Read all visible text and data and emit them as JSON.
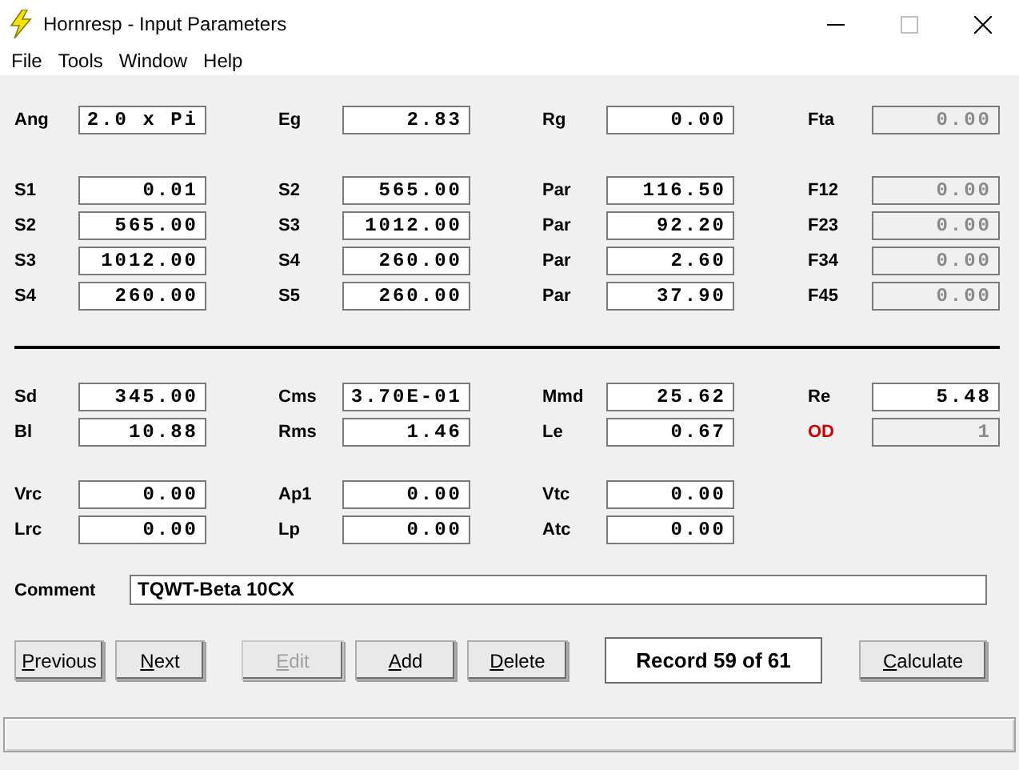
{
  "window": {
    "title": "Hornresp - Input Parameters"
  },
  "menu": [
    "File",
    "Tools",
    "Window",
    "Help"
  ],
  "groups": [
    {
      "kind": "fields",
      "rows": [
        [
          {
            "label": "Ang",
            "value": "2.0 x Pi",
            "disabled": false,
            "alert": false
          },
          {
            "label": "Eg",
            "value": "2.83",
            "disabled": false,
            "alert": false
          },
          {
            "label": "Rg",
            "value": "0.00",
            "disabled": false,
            "alert": false
          },
          {
            "label": "Fta",
            "value": "0.00",
            "disabled": true,
            "alert": false
          }
        ]
      ]
    },
    {
      "kind": "fields",
      "rows": [
        [
          {
            "label": "S1",
            "value": "0.01",
            "disabled": false,
            "alert": false
          },
          {
            "label": "S2",
            "value": "565.00",
            "disabled": false,
            "alert": false
          },
          {
            "label": "Par",
            "value": "116.50",
            "disabled": false,
            "alert": false
          },
          {
            "label": "F12",
            "value": "0.00",
            "disabled": true,
            "alert": false
          }
        ],
        [
          {
            "label": "S2",
            "value": "565.00",
            "disabled": false,
            "alert": false
          },
          {
            "label": "S3",
            "value": "1012.00",
            "disabled": false,
            "alert": false
          },
          {
            "label": "Par",
            "value": "92.20",
            "disabled": false,
            "alert": false
          },
          {
            "label": "F23",
            "value": "0.00",
            "disabled": true,
            "alert": false
          }
        ],
        [
          {
            "label": "S3",
            "value": "1012.00",
            "disabled": false,
            "alert": false
          },
          {
            "label": "S4",
            "value": "260.00",
            "disabled": false,
            "alert": false
          },
          {
            "label": "Par",
            "value": "2.60",
            "disabled": false,
            "alert": false
          },
          {
            "label": "F34",
            "value": "0.00",
            "disabled": true,
            "alert": false
          }
        ],
        [
          {
            "label": "S4",
            "value": "260.00",
            "disabled": false,
            "alert": false
          },
          {
            "label": "S5",
            "value": "260.00",
            "disabled": false,
            "alert": false
          },
          {
            "label": "Par",
            "value": "37.90",
            "disabled": false,
            "alert": false
          },
          {
            "label": "F45",
            "value": "0.00",
            "disabled": true,
            "alert": false
          }
        ]
      ]
    },
    {
      "kind": "rule"
    },
    {
      "kind": "fields",
      "rows": [
        [
          {
            "label": "Sd",
            "value": "345.00",
            "disabled": false,
            "alert": false
          },
          {
            "label": "Cms",
            "value": "3.70E-01",
            "disabled": false,
            "alert": false
          },
          {
            "label": "Mmd",
            "value": "25.62",
            "disabled": false,
            "alert": false
          },
          {
            "label": "Re",
            "value": "5.48",
            "disabled": false,
            "alert": false
          }
        ],
        [
          {
            "label": "Bl",
            "value": "10.88",
            "disabled": false,
            "alert": false
          },
          {
            "label": "Rms",
            "value": "1.46",
            "disabled": false,
            "alert": false
          },
          {
            "label": "Le",
            "value": "0.67",
            "disabled": false,
            "alert": false
          },
          {
            "label": "OD",
            "value": "1",
            "disabled": true,
            "alert": true
          }
        ]
      ]
    },
    {
      "kind": "fields",
      "rows": [
        [
          {
            "label": "Vrc",
            "value": "0.00",
            "disabled": false,
            "alert": false
          },
          {
            "label": "Ap1",
            "value": "0.00",
            "disabled": false,
            "alert": false
          },
          {
            "label": "Vtc",
            "value": "0.00",
            "disabled": false,
            "alert": false
          }
        ],
        [
          {
            "label": "Lrc",
            "value": "0.00",
            "disabled": false,
            "alert": false
          },
          {
            "label": "Lp",
            "value": "0.00",
            "disabled": false,
            "alert": false
          },
          {
            "label": "Atc",
            "value": "0.00",
            "disabled": false,
            "alert": false
          }
        ]
      ]
    }
  ],
  "comment": {
    "label": "Comment",
    "value": "TQWT-Beta 10CX"
  },
  "buttons": [
    {
      "kind": "button",
      "label": "Previous",
      "disabled": false
    },
    {
      "kind": "button",
      "label": "Next",
      "disabled": false
    },
    {
      "kind": "button",
      "label": "Edit",
      "disabled": true
    },
    {
      "kind": "button",
      "label": "Add",
      "disabled": false
    },
    {
      "kind": "button",
      "label": "Delete",
      "disabled": false
    },
    {
      "kind": "display",
      "label": "Record 59 of 61"
    },
    {
      "kind": "button",
      "label": "Calculate",
      "disabled": false
    }
  ]
}
